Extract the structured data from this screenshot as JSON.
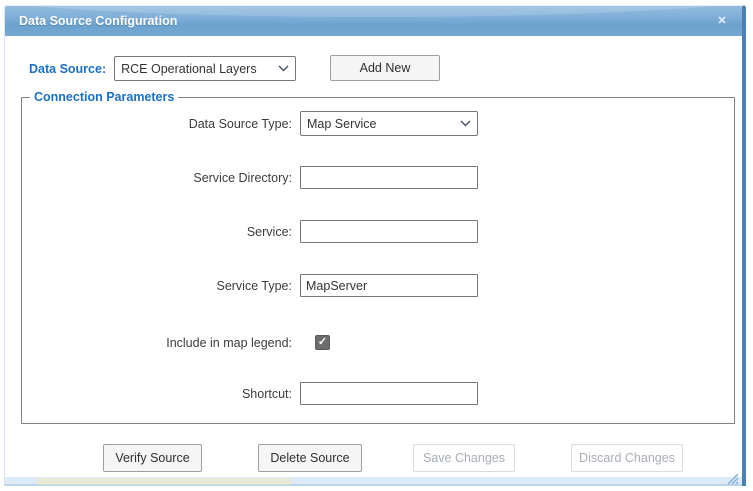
{
  "dialog": {
    "title": "Data Source Configuration"
  },
  "icons": {
    "close": "✕",
    "check": "✓"
  },
  "header_row": {
    "data_source_label": "Data Source:",
    "data_source_value": "RCE Operational Layers",
    "add_new_label": "Add New"
  },
  "connection_parameters": {
    "legend": "Connection Parameters",
    "fields": [
      {
        "label": "Data Source Type:",
        "type": "select",
        "value": "Map Service"
      },
      {
        "label": "Service Directory:",
        "type": "text",
        "value": ""
      },
      {
        "label": "Service:",
        "type": "text",
        "value": ""
      },
      {
        "label": "Service Type:",
        "type": "text",
        "value": "MapServer"
      },
      {
        "label": "Include in map legend:",
        "type": "checkbox",
        "checked": true
      },
      {
        "label": "Shortcut:",
        "type": "text",
        "value": ""
      }
    ]
  },
  "footer_buttons": [
    {
      "label": "Verify Source",
      "enabled": true
    },
    {
      "label": "Delete Source",
      "enabled": true
    },
    {
      "label": "Save Changes",
      "enabled": false
    },
    {
      "label": "Discard Changes",
      "enabled": false
    }
  ],
  "colors": {
    "titlebar_blue": "#7fafd8",
    "accent_label_blue": "#1a6fc4",
    "dialog_right_border": "#4c7fb2",
    "bottom_strip": "#dcebf7"
  }
}
